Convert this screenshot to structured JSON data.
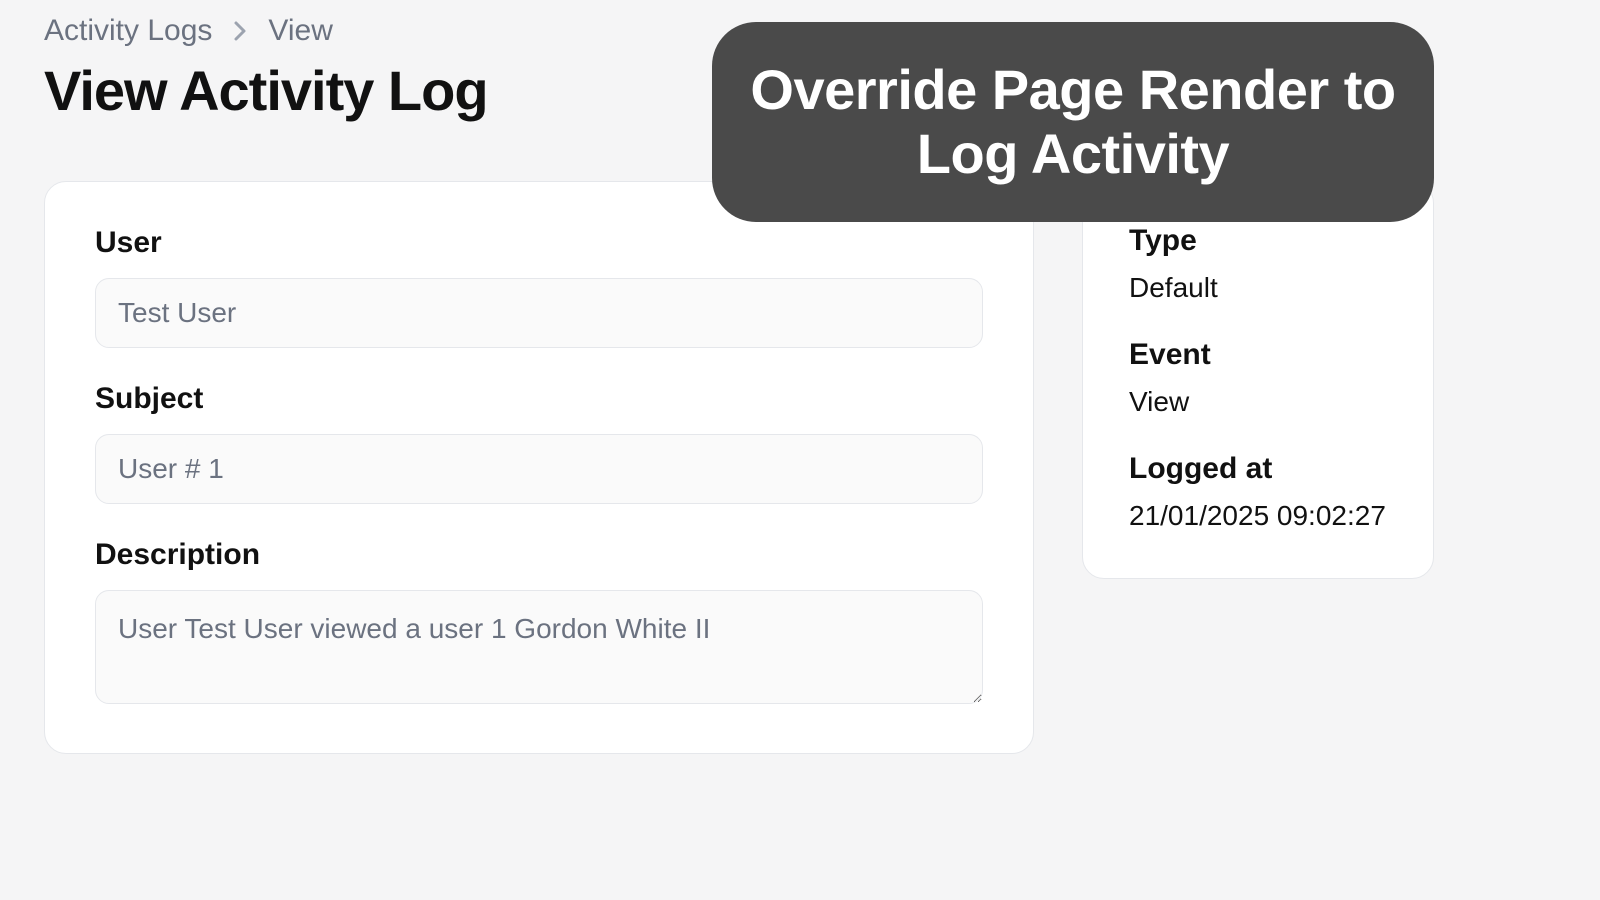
{
  "breadcrumb": {
    "root": "Activity Logs",
    "current": "View"
  },
  "page_title": "View Activity Log",
  "form": {
    "user": {
      "label": "User",
      "value": "Test User"
    },
    "subject": {
      "label": "Subject",
      "value": "User # 1"
    },
    "description": {
      "label": "Description",
      "value": "User Test User viewed a user 1 Gordon White II"
    }
  },
  "meta": {
    "type": {
      "label": "Type",
      "value": "Default"
    },
    "event": {
      "label": "Event",
      "value": "View"
    },
    "logged_at": {
      "label": "Logged at",
      "value": "21/01/2025 09:02:27"
    }
  },
  "overlay": "Override Page Render to Log Activity"
}
